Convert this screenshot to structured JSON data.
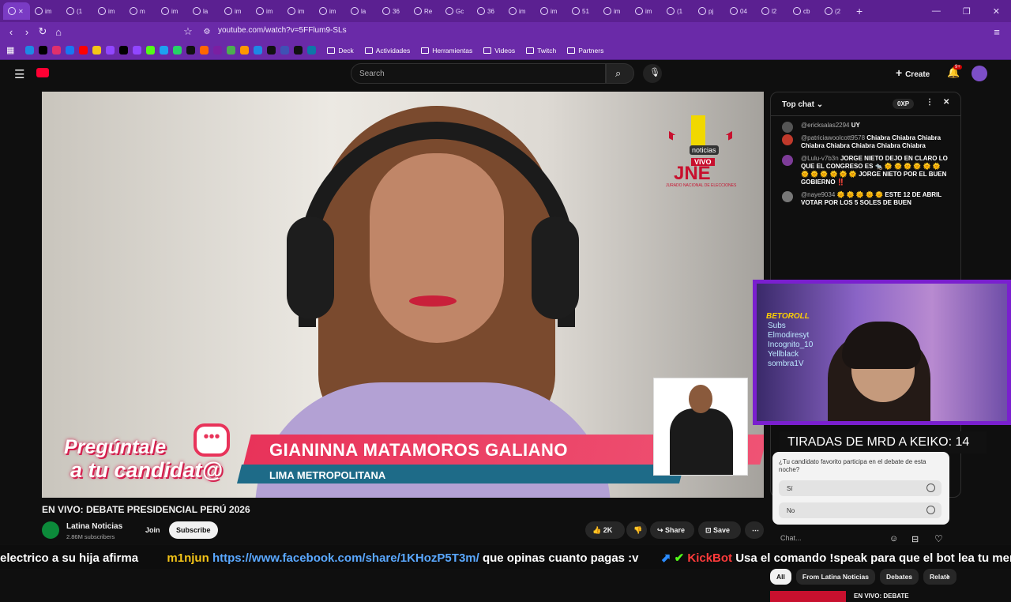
{
  "browser": {
    "tabs": [
      {
        "label": "im"
      },
      {
        "label": "(1"
      },
      {
        "label": "im"
      },
      {
        "label": "m"
      },
      {
        "label": "im"
      },
      {
        "label": "la"
      },
      {
        "label": "im"
      },
      {
        "label": "im"
      },
      {
        "label": "im"
      },
      {
        "label": "im"
      },
      {
        "label": "la"
      },
      {
        "label": "36"
      },
      {
        "label": "Re"
      },
      {
        "label": "Gc"
      },
      {
        "label": "36"
      },
      {
        "label": "im"
      },
      {
        "label": "im"
      },
      {
        "label": "51"
      },
      {
        "label": "im"
      },
      {
        "label": "im"
      },
      {
        "label": "(1"
      },
      {
        "label": "pj"
      },
      {
        "label": "04"
      },
      {
        "label": "l2"
      },
      {
        "label": "cb"
      },
      {
        "label": "(2"
      }
    ],
    "url": "youtube.com/watch?v=5FFlum9-SLs",
    "bookmarks": {
      "folders": [
        "Deck",
        "Actividades",
        "Herramientas",
        "Videos",
        "Twitch",
        "Partners"
      ]
    }
  },
  "youtube": {
    "search_placeholder": "Search",
    "create_label": "Create",
    "notif_badge": "9+",
    "video": {
      "title": "EN VIVO: DEBATE PRESIDENCIAL PERÚ 2026",
      "logo_small": "noticias",
      "logo_vivo": "VIVO",
      "logo_main": "JNE",
      "logo_sub": "JURADO NACIONAL DE ELECCIONES",
      "banner_line1": "Pregúntale",
      "banner_line2": "a tu candidat@",
      "lower_name": "GIANINNA MATAMOROS GALIANO",
      "lower_place": "LIMA METROPOLITANA"
    },
    "channel": {
      "name": "Latina Noticias",
      "subs": "2.86M subscribers",
      "join": "Join",
      "subscribe": "Subscribe",
      "likes": "2K",
      "share": "Share",
      "save": "Save"
    },
    "chat": {
      "header": "Top chat",
      "xp": "0XP",
      "messages": [
        {
          "author": "@ericksalas2294",
          "text": "UY",
          "color": "#555"
        },
        {
          "author": "@patriciawoolcott9578",
          "text": "Chiabra Chiabra Chiabra Chiabra Chiabra Chiabra Chiabra Chiabra",
          "color": "#c0392b"
        },
        {
          "author": "@Lulu-v7b3n",
          "text": "JORGE NIETO DEJO EN CLARO LO QUE EL CONGRESO ES 🐀 🌞 🌞 🌞 🌞 🌞 🌞 🌞 🌞 🌞 🌞 🌞 🌞 JORGE NIETO POR EL BUEN GOBIERNO ‼️",
          "color": "#7d3c98"
        },
        {
          "author": "@naye9034",
          "text": "🌞 🌞 🌞 🌞 🌞 ESTE 12 DE ABRIL VOTAR POR LOS 5 SOLES DE BUEN",
          "color": "#777"
        }
      ],
      "poll_question": "¿Tu candidato favorito participa en el debate de esta noche?",
      "poll_options": [
        "Sí",
        "No"
      ],
      "input_placeholder": "Chat..."
    },
    "overlay": {
      "brand": "BETOROLL",
      "subs_label": "Subs",
      "names": [
        "Elmodiresyt",
        "Incognito_10",
        "Yellblack",
        "sombra1V"
      ],
      "counter": "TIRADAS DE MRD A KEIKO: 14"
    },
    "chips": [
      "All",
      "From Latina Noticias",
      "Debates",
      "Relate"
    ],
    "recommended": {
      "title": "EN VIVO: DEBATE"
    }
  },
  "ticker": {
    "segment1": "electrico a su hija afirma",
    "user1": "m1njun",
    "link1": "https://www.facebook.com/share/1KHozP5T3m/",
    "text1": "que opinas cuanto pagas :v",
    "user2": "KickBot",
    "text2": "Usa el comando !speak para que el bot lea tu mensaje"
  },
  "colors": {
    "tab_bar": "#5b2091",
    "toolbar": "#6a2aa8",
    "yt_bg": "#0f0f0f",
    "accent_red": "#e8335a",
    "overlay_border": "#7a1fcf"
  }
}
